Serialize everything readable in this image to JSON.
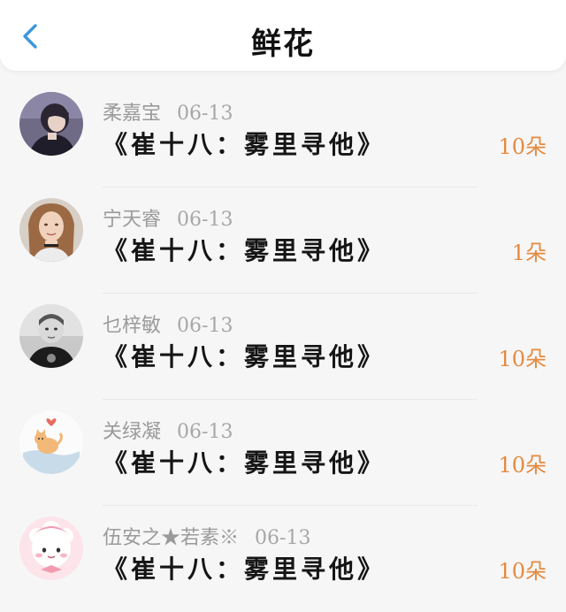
{
  "header": {
    "title": "鲜花",
    "back_icon": "chevron-left-icon",
    "accent_color": "#3a97de"
  },
  "unit_color": "#e58a3e",
  "rows": [
    {
      "name": "柔嘉宝",
      "date": "06-13",
      "book": "《崔十八：雾里寻他》",
      "count": "10朵",
      "avatar": "person-dark-hair"
    },
    {
      "name": "宁天睿",
      "date": "06-13",
      "book": "《崔十八：雾里寻他》",
      "count": "1朵",
      "avatar": "person-long-hair"
    },
    {
      "name": "乜梓敏",
      "date": "06-13",
      "book": "《崔十八：雾里寻他》",
      "count": "10朵",
      "avatar": "child-black-white"
    },
    {
      "name": "关绿凝",
      "date": "06-13",
      "book": "《崔十八：雾里寻他》",
      "count": "10朵",
      "avatar": "cartoon-cat"
    },
    {
      "name": "伍安之★若素※",
      "date": "06-13",
      "book": "《崔十八：雾里寻他》",
      "count": "10朵",
      "avatar": "cartoon-sheep"
    }
  ]
}
